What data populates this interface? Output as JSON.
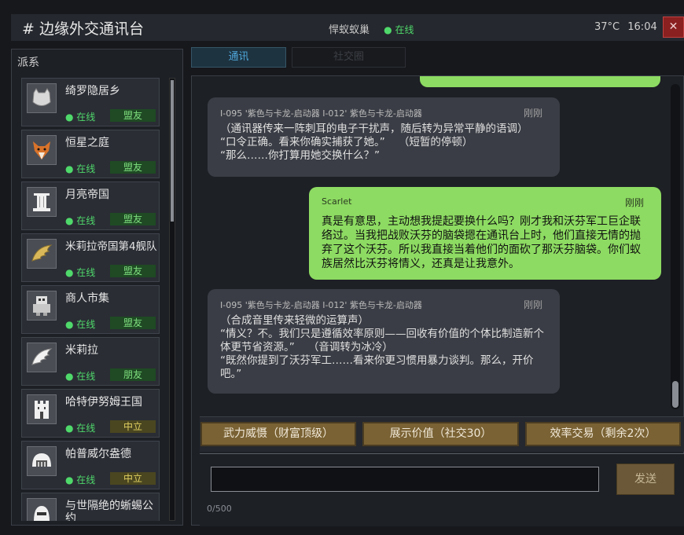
{
  "header": {
    "title": "# 边缘外交通讯台",
    "contact": "悍蚁蚁巢",
    "contact_status": "● 在线",
    "temperature": "37°C",
    "clock": "16:04",
    "close_label": "✕"
  },
  "sidebar": {
    "title": "派系",
    "factions": [
      {
        "name": "绮罗隐居乡",
        "status": "● 在线",
        "relation": "盟友",
        "relation_type": "ally",
        "icon": "cat-icon"
      },
      {
        "name": "恒星之庭",
        "status": "● 在线",
        "relation": "盟友",
        "relation_type": "ally",
        "icon": "fox-icon"
      },
      {
        "name": "月亮帝国",
        "status": "● 在线",
        "relation": "盟友",
        "relation_type": "ally",
        "icon": "pillar-icon"
      },
      {
        "name": "米莉拉帝国第4舰队",
        "status": "● 在线",
        "relation": "盟友",
        "relation_type": "ally",
        "icon": "wing-icon"
      },
      {
        "name": "商人市集",
        "status": "● 在线",
        "relation": "盟友",
        "relation_type": "ally",
        "icon": "robot-icon"
      },
      {
        "name": "米莉拉",
        "status": "● 在线",
        "relation": "朋友",
        "relation_type": "friend",
        "icon": "wing-icon"
      },
      {
        "name": "哈特伊努姆王国",
        "status": "● 在线",
        "relation": "中立",
        "relation_type": "neutral",
        "icon": "castle-icon"
      },
      {
        "name": "帕普威尔盎德",
        "status": "● 在线",
        "relation": "中立",
        "relation_type": "neutral",
        "icon": "dome-icon"
      },
      {
        "name": "与世隔绝的蜥蜴公约",
        "status": "",
        "relation": "",
        "relation_type": "",
        "icon": "helmet-icon"
      }
    ]
  },
  "tabs": {
    "comm": "通讯",
    "social": "社交圈"
  },
  "messages": [
    {
      "direction": "in",
      "sender": "I-095 '紫色与卡龙-启动器 I-012' 紫色与卡龙-启动器",
      "time": "刚刚",
      "text": "（通讯器传来一阵刺耳的电子干扰声，随后转为异常平静的语调）\n“口令正确。看来你确实捕获了她。”    （短暂的停顿）\n“那么……你打算用她交换什么？”"
    },
    {
      "direction": "out",
      "sender": "Scarlet",
      "time": "刚刚",
      "text": "真是有意思，主动想我提起要换什么吗？刚才我和沃芬军工巨企联络过。当我把战败沃芬的脑袋摁在通讯台上时，他们直接无情的抛弃了这个沃芬。所以我直接当着他们的面砍了那沃芬脑袋。你们蚁族居然比沃芬将情义，还真是让我意外。"
    },
    {
      "direction": "in",
      "sender": "I-095 '紫色与卡龙-启动器 I-012' 紫色与卡龙-启动器",
      "time": "刚刚",
      "text": "（合成音里传来轻微的运算声）\n“情义？不。我们只是遵循效率原则——回收有价值的个体比制造新个体更节省资源。”    （音调转为冰冷）\n“既然你提到了沃芬军工……看来你更习惯用暴力谈判。那么，开价吧。”"
    }
  ],
  "actions": {
    "force": "武力威慑（财富顶级）",
    "value": "展示价值（社交30）",
    "trade": "效率交易（剩余2次）"
  },
  "input": {
    "value": "",
    "placeholder": "",
    "counter": "0/500",
    "send_label": "发送"
  }
}
